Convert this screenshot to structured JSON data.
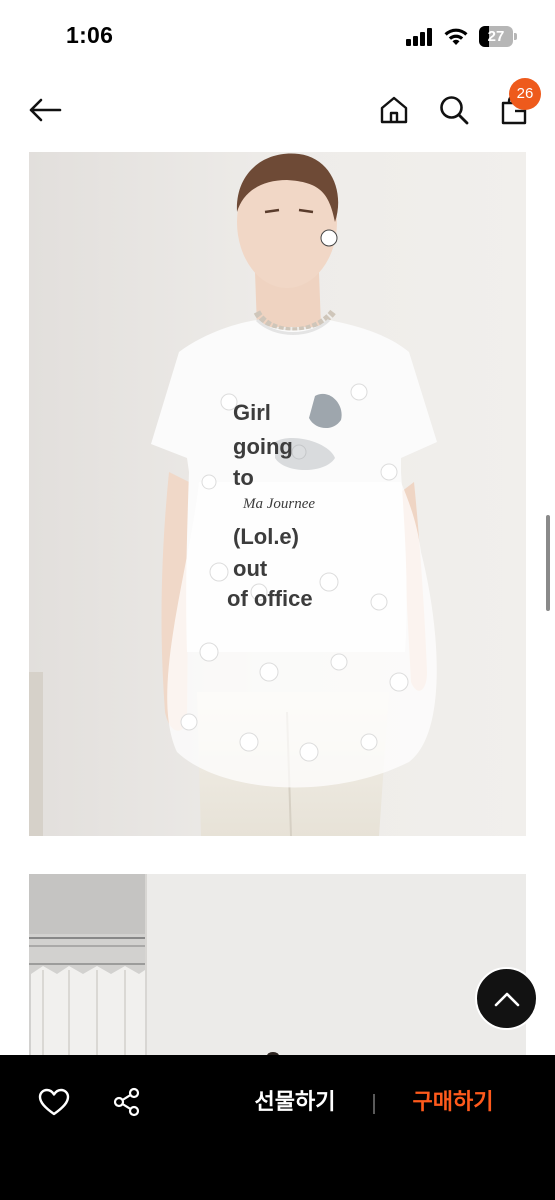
{
  "status_bar": {
    "time": "1:06",
    "battery_level": "27"
  },
  "header": {
    "cart_badge_count": "26"
  },
  "product_photo": {
    "shirt_print_lines": [
      "Girl",
      "going",
      "to",
      "Ma Journee",
      "(Lol.e)",
      "out",
      "of office"
    ]
  },
  "bottom_bar": {
    "gift_label": "선물하기",
    "buy_label": "구매하기",
    "buy_color": "#ff5a1c"
  },
  "colors": {
    "badge": "#ee5a1c",
    "bar_background": "#000000"
  }
}
